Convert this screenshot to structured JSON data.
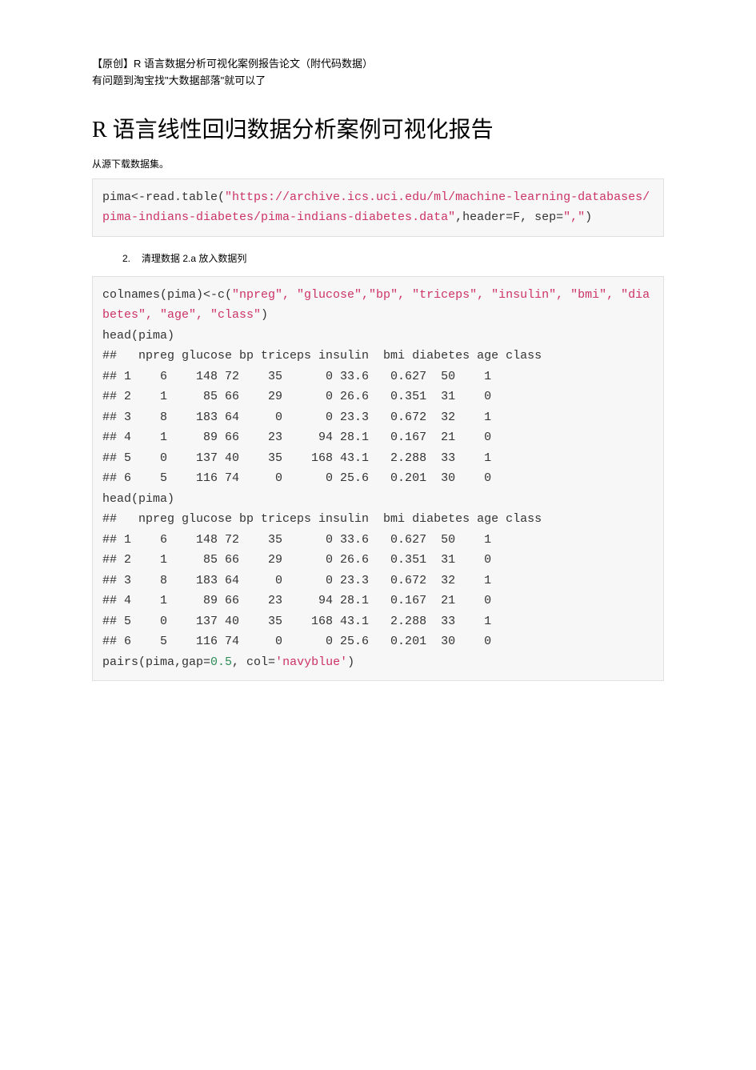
{
  "header": {
    "line1": "【原创】R 语言数据分析可视化案例报告论文（附代码数据）",
    "line2": "有问题到淘宝找\"大数据部落\"就可以了"
  },
  "title": "R 语言线性回归数据分析案例可视化报告",
  "intro": "从源下载数据集。",
  "code1": {
    "prefix": "pima<-read.table(",
    "string_part": "\"https://archive.ics.uci.edu/ml/machine-learning-databases/pima-indians-diabetes/pima-indians-diabetes.data\"",
    "suffix1": ",header=F, sep=",
    "sep_str": "\",\"",
    "suffix2": ")"
  },
  "list": {
    "num": "2.",
    "text": "清理数据 2.a 放入数据列"
  },
  "code2": {
    "line_colnames_pre": "colnames(pima)<-c(",
    "colnames_strings": "\"npreg\", \"glucose\",\"bp\", \"triceps\", \"insulin\", \"bmi\", \"diabetes\", \"age\", \"class\"",
    "line_colnames_post": ")",
    "head1": "head(pima)",
    "out_header": "##   npreg glucose bp triceps insulin  bmi diabetes age class",
    "out_r1": "## 1    6    148 72    35      0 33.6   0.627  50    1",
    "out_r2": "## 2    1     85 66    29      0 26.6   0.351  31    0",
    "out_r3": "## 3    8    183 64     0      0 23.3   0.672  32    1",
    "out_r4": "## 4    1     89 66    23     94 28.1   0.167  21    0",
    "out_r5": "## 5    0    137 40    35    168 43.1   2.288  33    1",
    "out_r6": "## 6    5    116 74     0      0 25.6   0.201  30    0",
    "head2": "head(pima)",
    "out2_header": "##   npreg glucose bp triceps insulin  bmi diabetes age class",
    "out2_r1": "## 1    6    148 72    35      0 33.6   0.627  50    1",
    "out2_r2": "## 2    1     85 66    29      0 26.6   0.351  31    0",
    "out2_r3": "## 3    8    183 64     0      0 23.3   0.672  32    1",
    "out2_r4": "## 4    1     89 66    23     94 28.1   0.167  21    0",
    "out2_r5": "## 5    0    137 40    35    168 43.1   2.288  33    1",
    "out2_r6": "## 6    5    116 74     0      0 25.6   0.201  30    0",
    "pairs_pre": "pairs(pima,gap=",
    "pairs_num": "0.5",
    "pairs_mid": ", col=",
    "pairs_str": "'navyblue'",
    "pairs_post": ")"
  }
}
